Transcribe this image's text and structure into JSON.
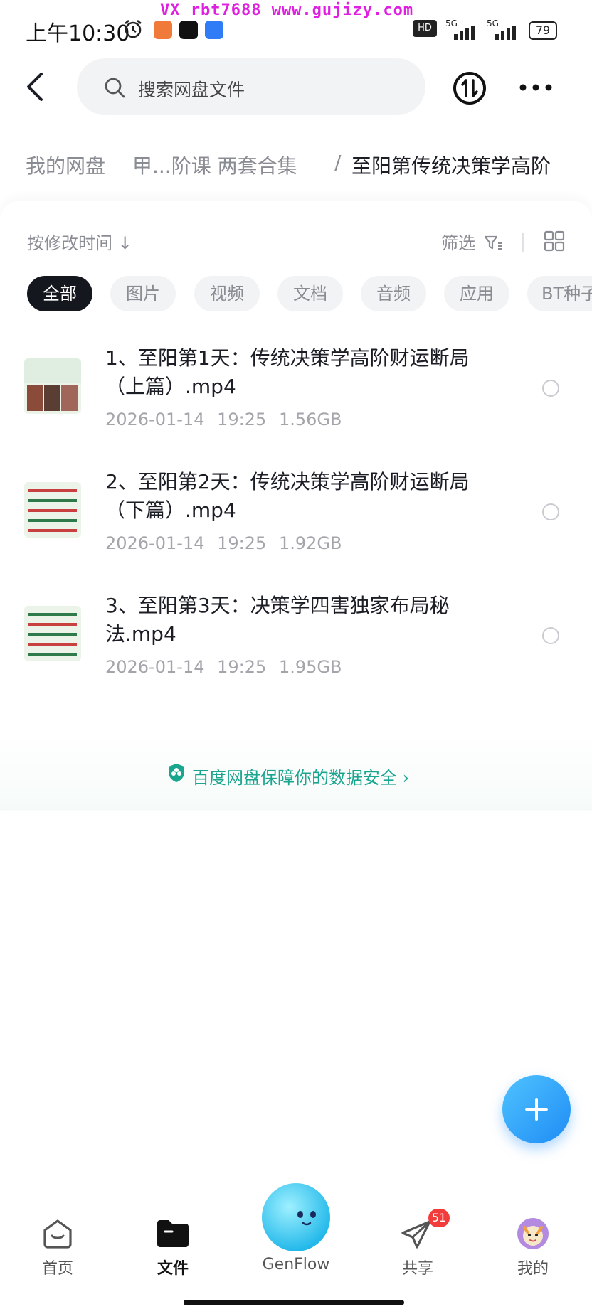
{
  "status_bar": {
    "time": "上午10:30",
    "watermark": "VX rbt7688  www.gujizy.com",
    "battery": "79",
    "network1": "5G",
    "network2": "5G"
  },
  "header": {
    "search_placeholder": "搜索网盘文件"
  },
  "breadcrumb": {
    "root": "我的网盘",
    "middle": "甲...阶课 两套合集",
    "separator": "/",
    "current": "至阳第传统决策学高阶"
  },
  "toolbar": {
    "sort_label": "按修改时间",
    "sort_arrow": "↓",
    "filter_label": "筛选"
  },
  "categories": [
    "全部",
    "图片",
    "视频",
    "文档",
    "音频",
    "应用",
    "BT种子"
  ],
  "files": [
    {
      "name": "1、至阳第1天：传统决策学高阶财运断局（上篇）.mp4",
      "date": "2026-01-14",
      "time": "19:25",
      "size": "1.56GB"
    },
    {
      "name": "2、至阳第2天：传统决策学高阶财运断局（下篇）.mp4",
      "date": "2026-01-14",
      "time": "19:25",
      "size": "1.92GB"
    },
    {
      "name": "3、至阳第3天：决策学四害独家布局秘法.mp4",
      "date": "2026-01-14",
      "time": "19:25",
      "size": "1.95GB"
    }
  ],
  "security_banner": "百度网盘保障你的数据安全",
  "nav": {
    "home": "首页",
    "files": "文件",
    "genflow": "GenFlow",
    "share": "共享",
    "share_badge": "51",
    "mine": "我的"
  },
  "colors": {
    "accent_green": "#1aa58f",
    "fab_blue": "#1e8cf5",
    "badge_red": "#f23c3c",
    "active_chip": "#15171f"
  }
}
